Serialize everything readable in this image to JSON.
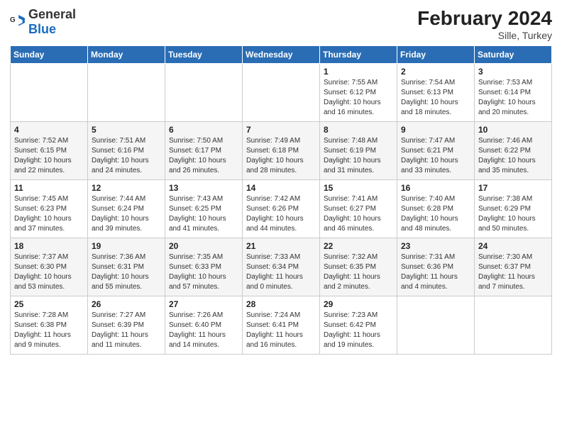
{
  "header": {
    "logo_general": "General",
    "logo_blue": "Blue",
    "month_year": "February 2024",
    "location": "Sille, Turkey"
  },
  "days_of_week": [
    "Sunday",
    "Monday",
    "Tuesday",
    "Wednesday",
    "Thursday",
    "Friday",
    "Saturday"
  ],
  "weeks": [
    [
      {
        "day": "",
        "info": ""
      },
      {
        "day": "",
        "info": ""
      },
      {
        "day": "",
        "info": ""
      },
      {
        "day": "",
        "info": ""
      },
      {
        "day": "1",
        "info": "Sunrise: 7:55 AM\nSunset: 6:12 PM\nDaylight: 10 hours\nand 16 minutes."
      },
      {
        "day": "2",
        "info": "Sunrise: 7:54 AM\nSunset: 6:13 PM\nDaylight: 10 hours\nand 18 minutes."
      },
      {
        "day": "3",
        "info": "Sunrise: 7:53 AM\nSunset: 6:14 PM\nDaylight: 10 hours\nand 20 minutes."
      }
    ],
    [
      {
        "day": "4",
        "info": "Sunrise: 7:52 AM\nSunset: 6:15 PM\nDaylight: 10 hours\nand 22 minutes."
      },
      {
        "day": "5",
        "info": "Sunrise: 7:51 AM\nSunset: 6:16 PM\nDaylight: 10 hours\nand 24 minutes."
      },
      {
        "day": "6",
        "info": "Sunrise: 7:50 AM\nSunset: 6:17 PM\nDaylight: 10 hours\nand 26 minutes."
      },
      {
        "day": "7",
        "info": "Sunrise: 7:49 AM\nSunset: 6:18 PM\nDaylight: 10 hours\nand 28 minutes."
      },
      {
        "day": "8",
        "info": "Sunrise: 7:48 AM\nSunset: 6:19 PM\nDaylight: 10 hours\nand 31 minutes."
      },
      {
        "day": "9",
        "info": "Sunrise: 7:47 AM\nSunset: 6:21 PM\nDaylight: 10 hours\nand 33 minutes."
      },
      {
        "day": "10",
        "info": "Sunrise: 7:46 AM\nSunset: 6:22 PM\nDaylight: 10 hours\nand 35 minutes."
      }
    ],
    [
      {
        "day": "11",
        "info": "Sunrise: 7:45 AM\nSunset: 6:23 PM\nDaylight: 10 hours\nand 37 minutes."
      },
      {
        "day": "12",
        "info": "Sunrise: 7:44 AM\nSunset: 6:24 PM\nDaylight: 10 hours\nand 39 minutes."
      },
      {
        "day": "13",
        "info": "Sunrise: 7:43 AM\nSunset: 6:25 PM\nDaylight: 10 hours\nand 41 minutes."
      },
      {
        "day": "14",
        "info": "Sunrise: 7:42 AM\nSunset: 6:26 PM\nDaylight: 10 hours\nand 44 minutes."
      },
      {
        "day": "15",
        "info": "Sunrise: 7:41 AM\nSunset: 6:27 PM\nDaylight: 10 hours\nand 46 minutes."
      },
      {
        "day": "16",
        "info": "Sunrise: 7:40 AM\nSunset: 6:28 PM\nDaylight: 10 hours\nand 48 minutes."
      },
      {
        "day": "17",
        "info": "Sunrise: 7:38 AM\nSunset: 6:29 PM\nDaylight: 10 hours\nand 50 minutes."
      }
    ],
    [
      {
        "day": "18",
        "info": "Sunrise: 7:37 AM\nSunset: 6:30 PM\nDaylight: 10 hours\nand 53 minutes."
      },
      {
        "day": "19",
        "info": "Sunrise: 7:36 AM\nSunset: 6:31 PM\nDaylight: 10 hours\nand 55 minutes."
      },
      {
        "day": "20",
        "info": "Sunrise: 7:35 AM\nSunset: 6:33 PM\nDaylight: 10 hours\nand 57 minutes."
      },
      {
        "day": "21",
        "info": "Sunrise: 7:33 AM\nSunset: 6:34 PM\nDaylight: 11 hours\nand 0 minutes."
      },
      {
        "day": "22",
        "info": "Sunrise: 7:32 AM\nSunset: 6:35 PM\nDaylight: 11 hours\nand 2 minutes."
      },
      {
        "day": "23",
        "info": "Sunrise: 7:31 AM\nSunset: 6:36 PM\nDaylight: 11 hours\nand 4 minutes."
      },
      {
        "day": "24",
        "info": "Sunrise: 7:30 AM\nSunset: 6:37 PM\nDaylight: 11 hours\nand 7 minutes."
      }
    ],
    [
      {
        "day": "25",
        "info": "Sunrise: 7:28 AM\nSunset: 6:38 PM\nDaylight: 11 hours\nand 9 minutes."
      },
      {
        "day": "26",
        "info": "Sunrise: 7:27 AM\nSunset: 6:39 PM\nDaylight: 11 hours\nand 11 minutes."
      },
      {
        "day": "27",
        "info": "Sunrise: 7:26 AM\nSunset: 6:40 PM\nDaylight: 11 hours\nand 14 minutes."
      },
      {
        "day": "28",
        "info": "Sunrise: 7:24 AM\nSunset: 6:41 PM\nDaylight: 11 hours\nand 16 minutes."
      },
      {
        "day": "29",
        "info": "Sunrise: 7:23 AM\nSunset: 6:42 PM\nDaylight: 11 hours\nand 19 minutes."
      },
      {
        "day": "",
        "info": ""
      },
      {
        "day": "",
        "info": ""
      }
    ]
  ]
}
